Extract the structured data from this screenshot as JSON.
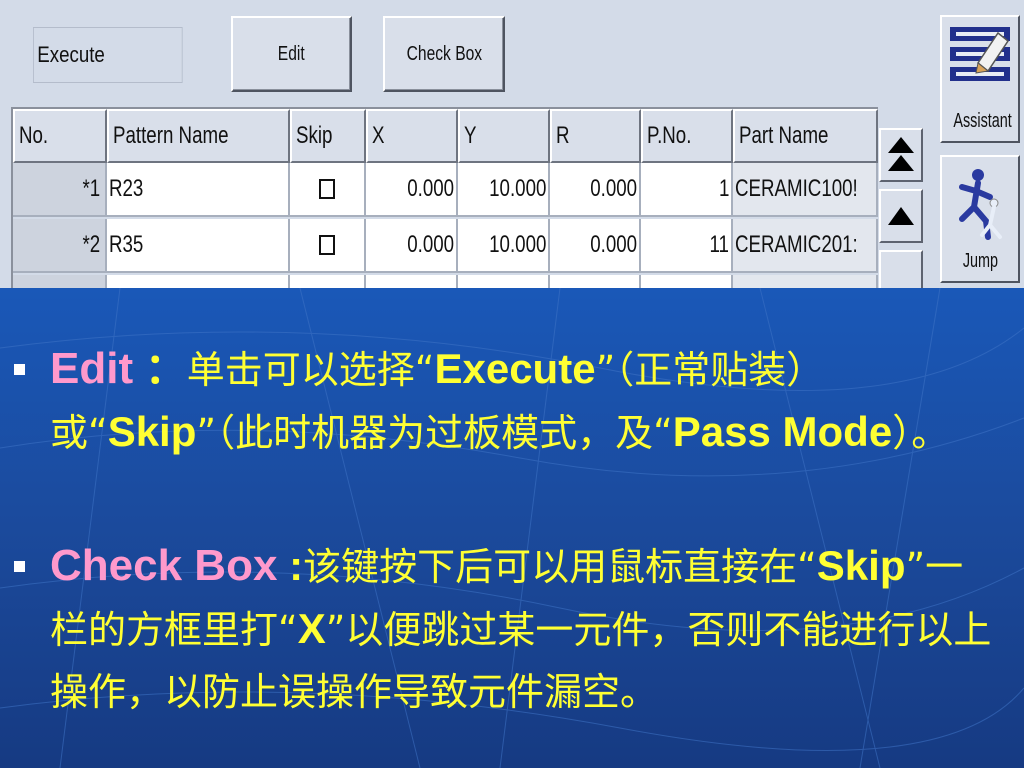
{
  "ui": {
    "mode_value": "Execute",
    "buttons": {
      "edit": "Edit",
      "check_box": "Check Box"
    },
    "table": {
      "headers": [
        "No.",
        "Pattern Name",
        "Skip",
        "X",
        "Y",
        "R",
        "P.No.",
        "Part Name"
      ],
      "rows": [
        {
          "no": "*1",
          "pattern": "R23",
          "x": "0.000",
          "y": "10.000",
          "r": "0.000",
          "pno": "1",
          "part": "CERAMIC100!"
        },
        {
          "no": "*2",
          "pattern": "R35",
          "x": "0.000",
          "y": "10.000",
          "r": "0.000",
          "pno": "11",
          "part": "CERAMIC201:"
        }
      ]
    },
    "side_buttons": {
      "assistant": "Assistant",
      "jump": "Jump"
    },
    "icons": {
      "scroll_top": "double-up-arrow-icon",
      "scroll_up": "up-arrow-icon",
      "assistant": "assistant-icon",
      "jump": "running-man-icon"
    }
  },
  "slide": {
    "colors": {
      "background": "#1b4fa6",
      "text": "#ffff33",
      "keyword": "#ff99cc",
      "bullet": "#ffffff"
    },
    "bullet1": {
      "keyword": "Edit",
      "colon": " ：",
      "t1": "单击可以选择“",
      "b1": "Execute",
      "t2": "”（正常贴装）或“",
      "b2": "Skip",
      "t3": "”（此时机器为过板模式，及“",
      "b3": "Pass Mode",
      "t4": "）。"
    },
    "bullet2": {
      "keyword": "Check Box",
      "colon": " :",
      "t1": "该键按下后可以用鼠标直接在“",
      "b1": "Skip",
      "t2": "”一栏的方框里打“",
      "b2": "X",
      "t3": "”以便跳过某一元件，否则不能进行以上操作，以防止误操作导致元件漏空。"
    }
  }
}
